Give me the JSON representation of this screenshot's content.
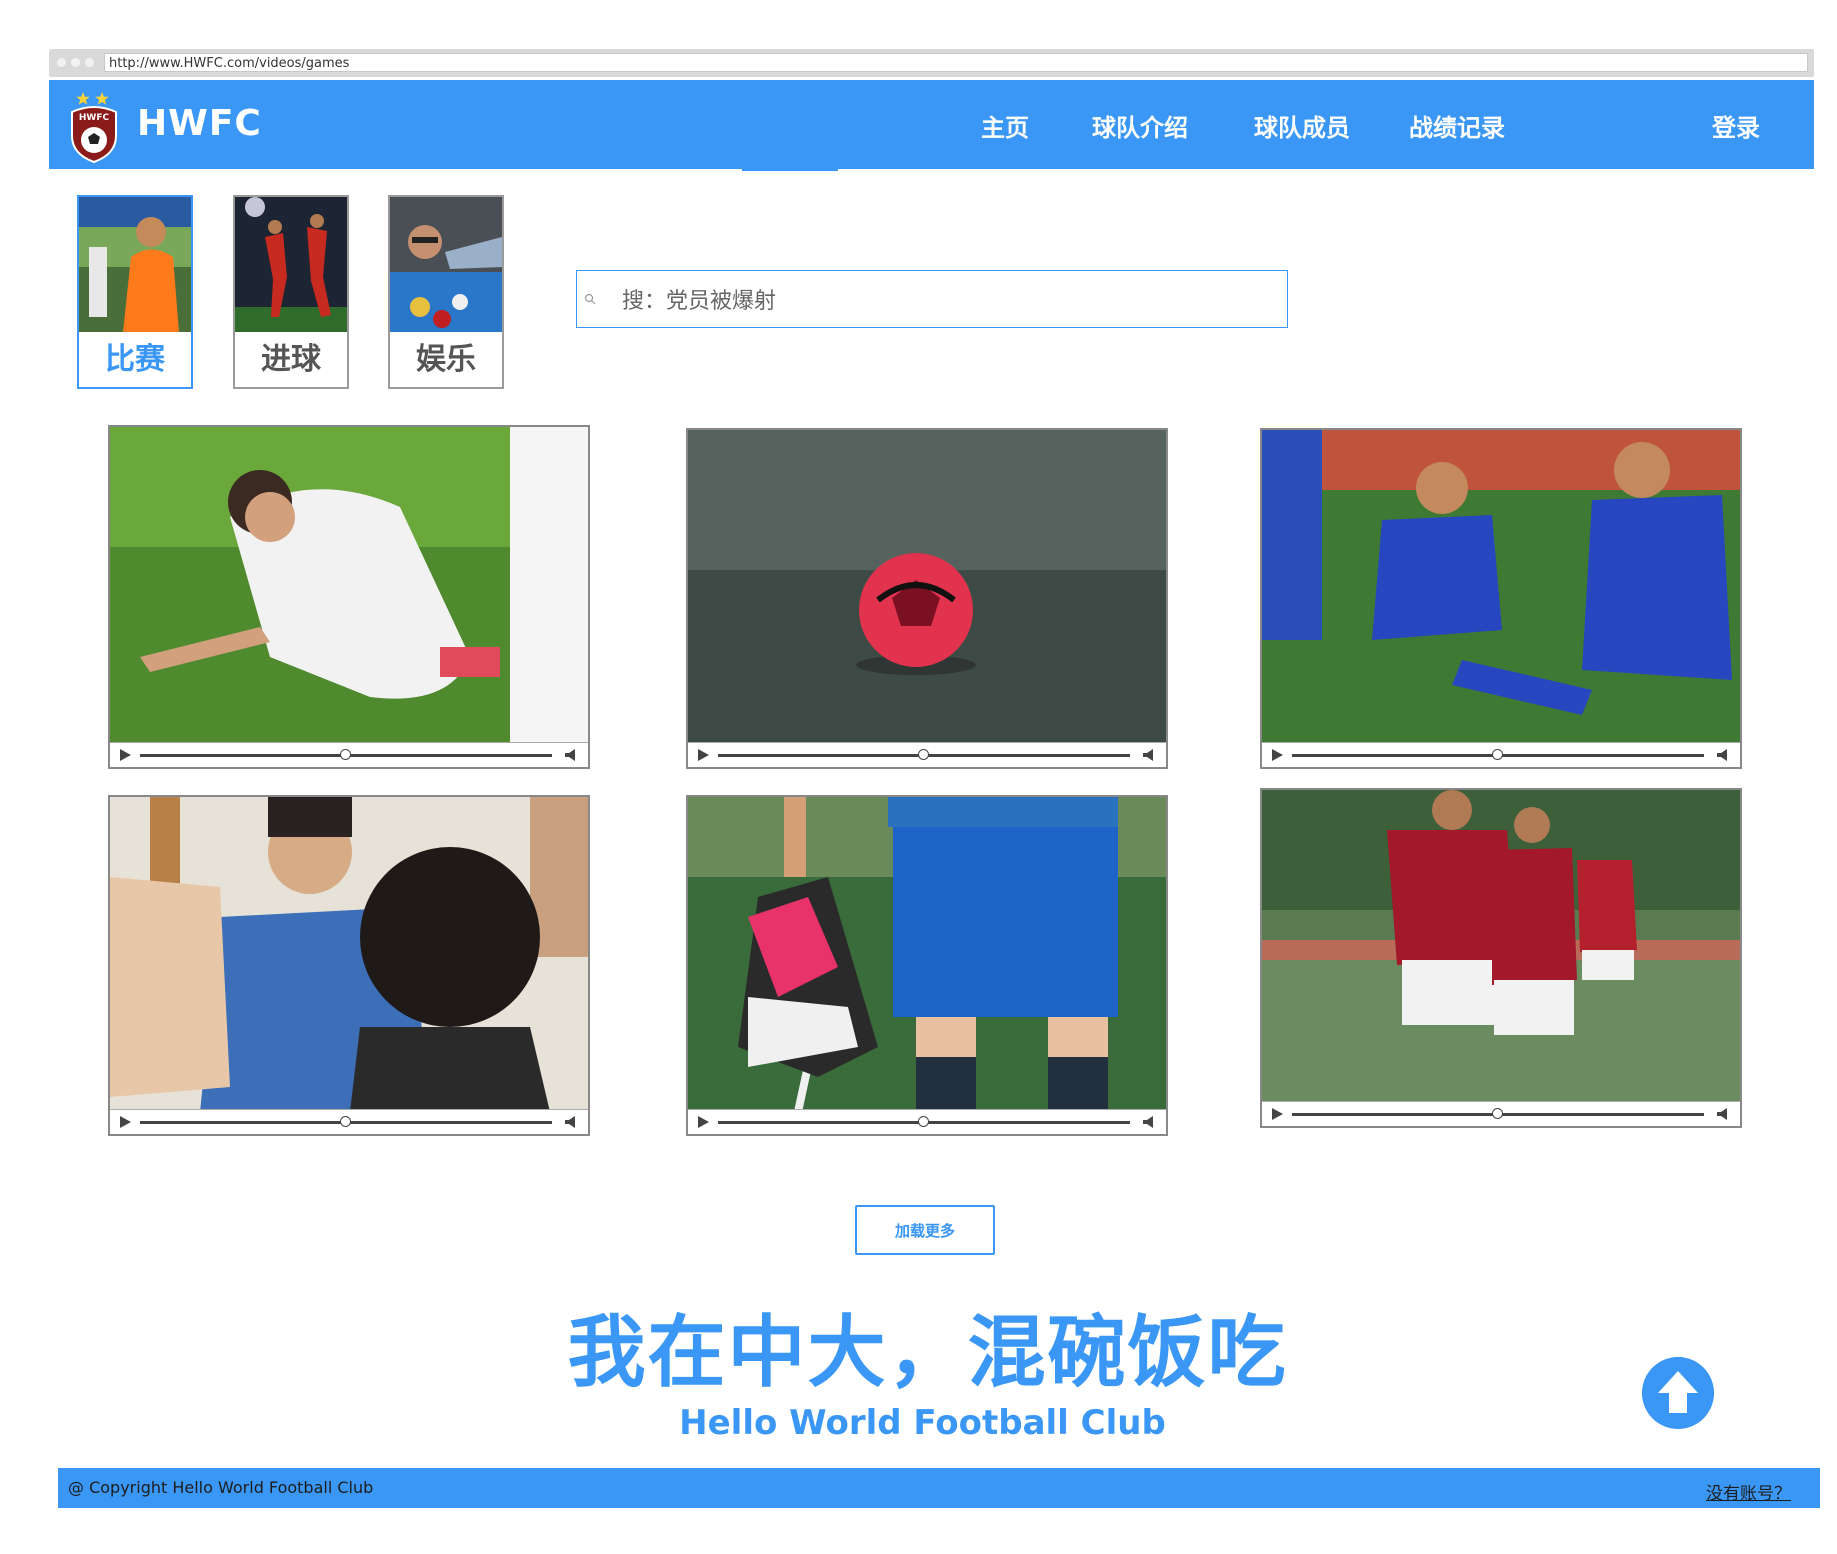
{
  "browser": {
    "url": "http://www.HWFC.com/videos/games"
  },
  "header": {
    "brand": "HWFC",
    "logo_text": "HWFC",
    "nav": [
      "主页",
      "球队介绍",
      "球队成员",
      "战绩记录"
    ],
    "login": "登录"
  },
  "categories": [
    {
      "label": "比赛",
      "active": true
    },
    {
      "label": "进球",
      "active": false
    },
    {
      "label": "娱乐",
      "active": false
    }
  ],
  "search": {
    "placeholder": "搜：党员被爆射"
  },
  "videos": [
    {
      "scene": "player-lying-on-grass",
      "progress": 0.5
    },
    {
      "scene": "red-ball-on-turf",
      "progress": 0.5
    },
    {
      "scene": "players-sitting-on-pitch",
      "progress": 0.5
    },
    {
      "scene": "team-huddle-closeup",
      "progress": 0.5
    },
    {
      "scene": "holding-football-boot",
      "progress": 0.5
    },
    {
      "scene": "players-in-red-jerseys",
      "progress": 0.5
    }
  ],
  "load_more": "加载更多",
  "slogan": "我在中大，混碗饭吃",
  "club_name": "Hello World Football Club",
  "footer": {
    "copyright": "@ Copyright Hello World Football Club",
    "signup_link": "没有账号？"
  },
  "colors": {
    "accent": "#3a97f5"
  }
}
